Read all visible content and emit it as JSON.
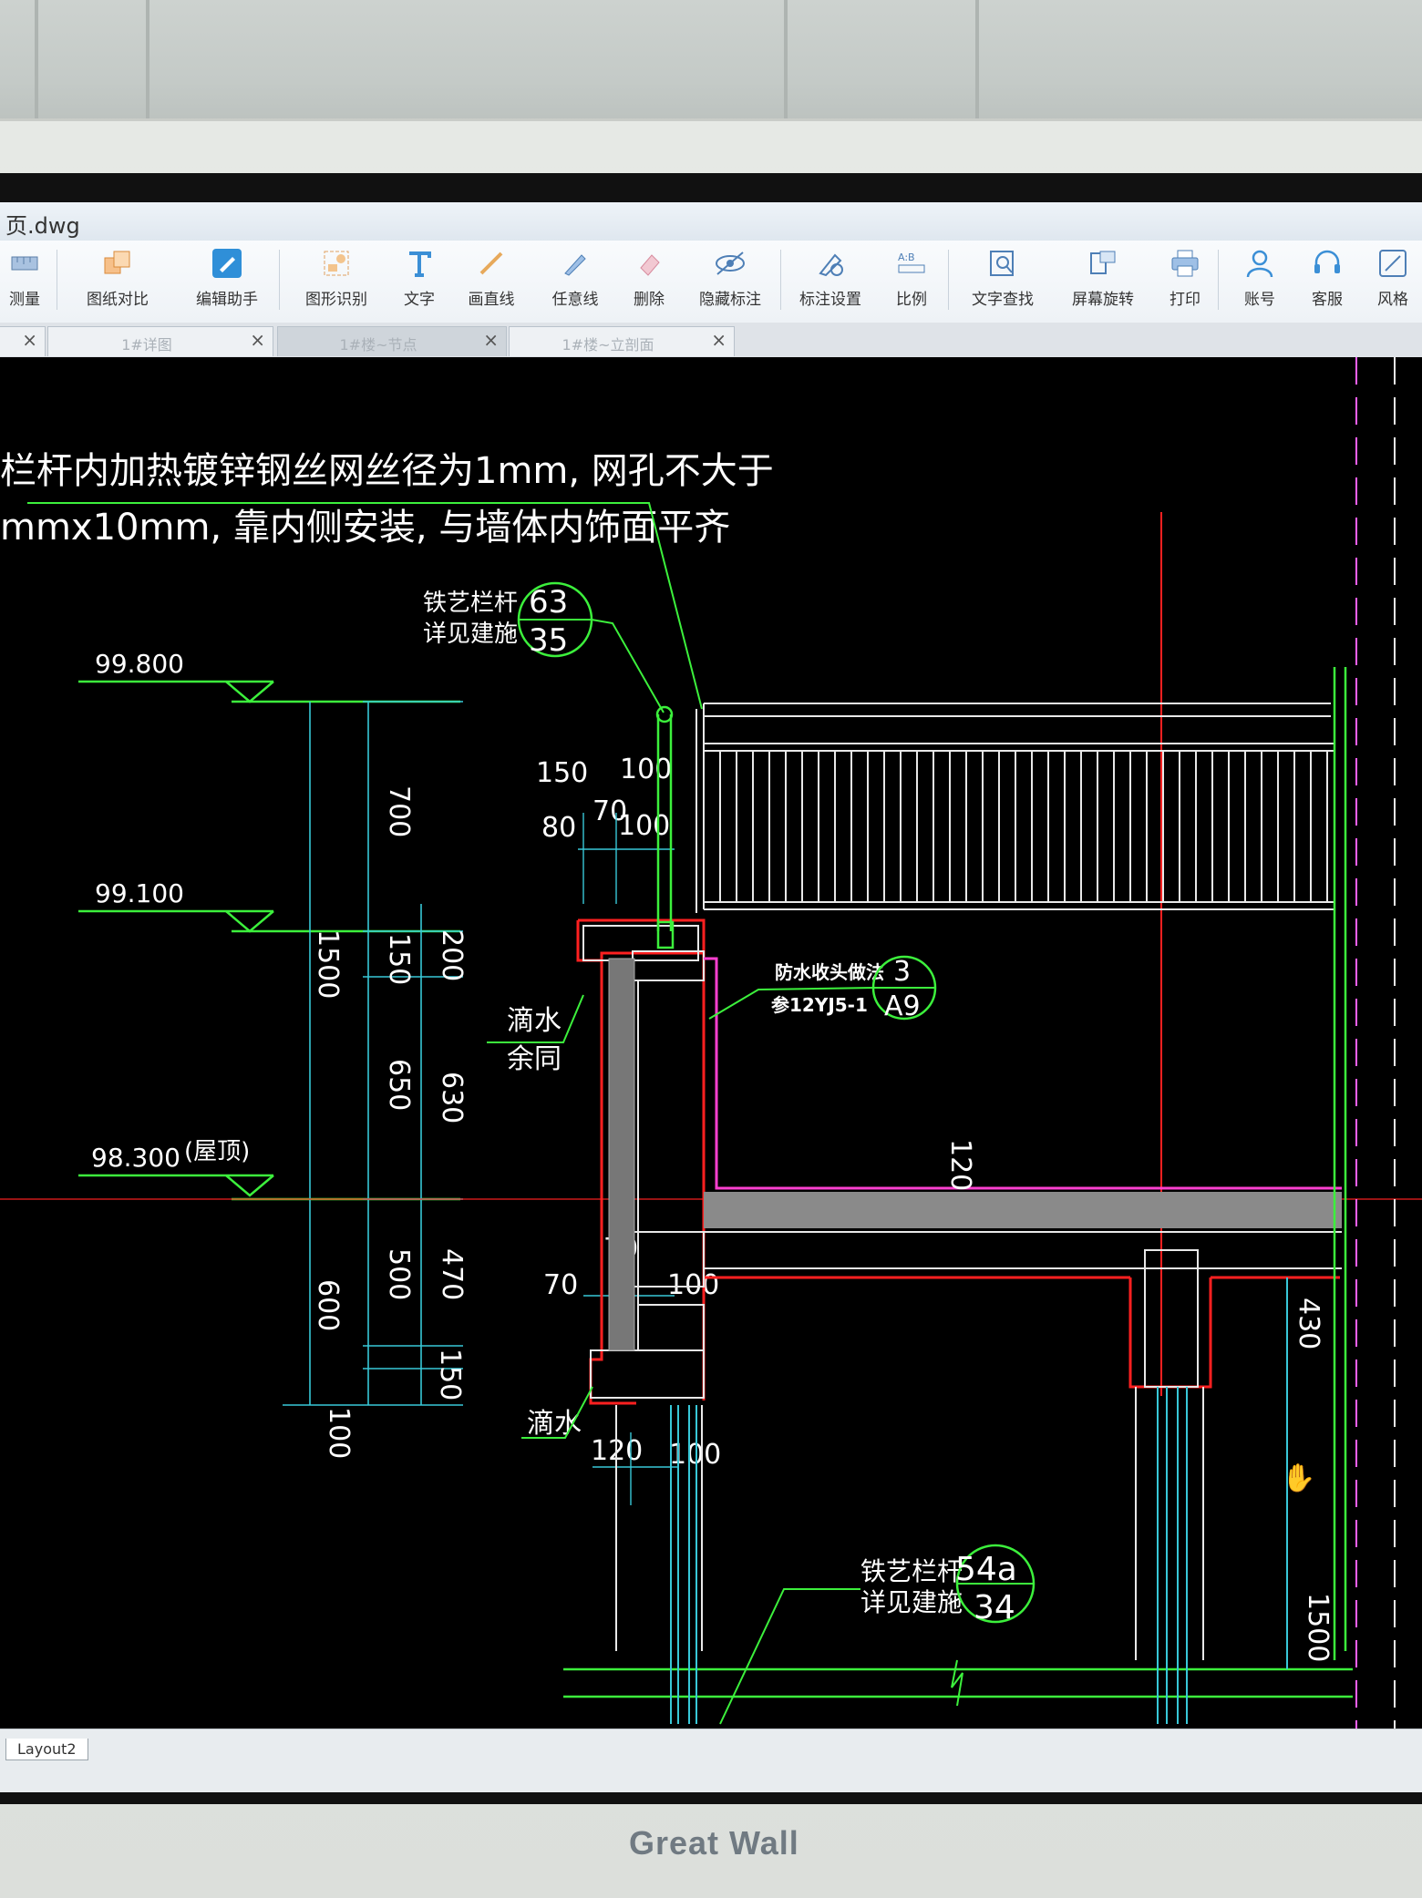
{
  "window": {
    "title": "页.dwg"
  },
  "toolbar": {
    "items": [
      {
        "label": "测量",
        "icon": "ruler-icon"
      },
      {
        "label": "图纸对比",
        "icon": "compare-icon"
      },
      {
        "label": "编辑助手",
        "icon": "edit-assistant-icon"
      },
      {
        "label": "图形识别",
        "icon": "shape-recognition-icon"
      },
      {
        "label": "文字",
        "icon": "text-icon"
      },
      {
        "label": "画直线",
        "icon": "line-icon"
      },
      {
        "label": "任意线",
        "icon": "freehand-icon"
      },
      {
        "label": "删除",
        "icon": "eraser-icon"
      },
      {
        "label": "隐藏标注",
        "icon": "hide-annotation-icon"
      },
      {
        "label": "标注设置",
        "icon": "annotation-settings-icon"
      },
      {
        "label": "比例",
        "icon": "scale-icon"
      },
      {
        "label": "文字查找",
        "icon": "text-search-icon"
      },
      {
        "label": "屏幕旋转",
        "icon": "rotate-screen-icon"
      },
      {
        "label": "打印",
        "icon": "printer-icon"
      },
      {
        "label": "账号",
        "icon": "account-icon"
      },
      {
        "label": "客服",
        "icon": "headset-icon"
      },
      {
        "label": "风格",
        "icon": "style-icon"
      }
    ]
  },
  "tabs": [
    {
      "label": "",
      "active": false
    },
    {
      "label": "1#详图",
      "active": false
    },
    {
      "label": "1#楼~节点",
      "active": true
    },
    {
      "label": "1#楼~立剖面",
      "active": false
    }
  ],
  "drawing": {
    "note_line1": "栏杆内加热镀锌钢丝网丝径为1mm, 网孔不大于",
    "note_line2": "mmx10mm, 靠内侧安装, 与墙体内饰面平齐",
    "callout_rail_top": {
      "text1": "铁艺栏杆",
      "text2": "详见建施",
      "num": "63",
      "sheet": "35"
    },
    "callout_waterproof": {
      "text1": "防水收头做法",
      "text2": "参12YJ5-1",
      "num": "3",
      "sheet": "A9"
    },
    "callout_rail_bottom": {
      "text1": "铁艺栏杆",
      "text2": "详见建施",
      "num": "54a",
      "sheet": "34"
    },
    "elevations": [
      {
        "label": "99.800"
      },
      {
        "label": "99.100"
      },
      {
        "label": "98.300",
        "suffix": "(屋顶)"
      }
    ],
    "dimensions_left": [
      "700",
      "1500",
      "150",
      "200",
      "650",
      "630",
      "600",
      "500",
      "470",
      "150",
      "100"
    ],
    "dimensions_mid": [
      "150",
      "100",
      "70",
      "80",
      "100",
      "70",
      "70",
      "100",
      "120",
      "100"
    ],
    "dimensions_right": [
      "120",
      "430",
      "1500"
    ],
    "labels": {
      "drip1": "滴水",
      "drip_same": "余同",
      "drip2": "滴水"
    }
  },
  "status": {
    "layout_tab": "Layout2"
  },
  "monitor": {
    "brand": "Great Wall"
  },
  "colors": {
    "green": "#3cf03c",
    "cyan": "#38c8d8",
    "white": "#e8e8e8",
    "red": "#ff2020",
    "magenta": "#ff40d0"
  }
}
